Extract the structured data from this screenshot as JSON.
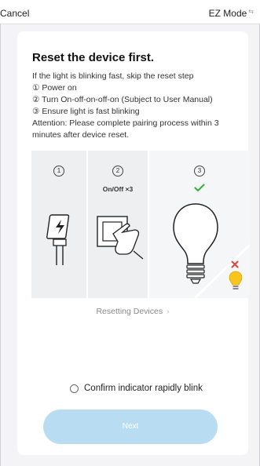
{
  "topbar": {
    "cancel_label": "Cancel",
    "mode_label": "EZ Mode",
    "mode_icon": "switch-icon"
  },
  "content": {
    "title": "Reset the device first.",
    "intro": "If the light is blinking fast, skip the reset step",
    "steps": [
      "① Power on",
      "② Turn On-off-on-off-on (Subject to User Manual)",
      "③ Ensure light is fast blinking"
    ],
    "attention": "Attention: Please complete pairing process within 3 minutes after device reset."
  },
  "illustration": {
    "step_numbers": [
      "1",
      "2",
      "3"
    ],
    "switch_caption": "On/Off ×3",
    "icons": [
      "plug-icon",
      "switch-press-icon",
      "check-icon",
      "bulb-off-icon",
      "cross-icon",
      "bulb-on-icon"
    ],
    "colors": {
      "check": "#3cb04a",
      "cross": "#e0453a",
      "bulb_on": "#f7c51b"
    }
  },
  "resetting_link": "Resetting Devices",
  "confirm_label": "Confirm indicator rapidly blink",
  "next_button": "Next",
  "colors": {
    "next_button_bg": "#b8ddf2",
    "page_bg": "#f4f4f6"
  }
}
